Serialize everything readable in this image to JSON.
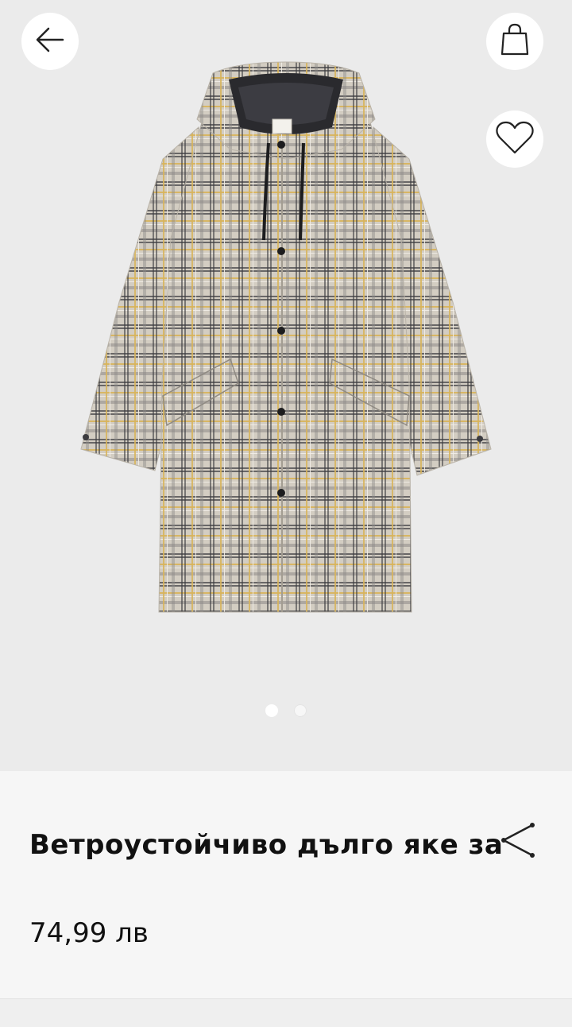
{
  "product": {
    "title": "Ветроустойчиво дълго яке за",
    "price": "74,99 лв"
  },
  "gallery": {
    "image_alt": "plaid-hooded-long-coat",
    "slides": [
      {
        "active": true
      },
      {
        "active": false
      }
    ]
  },
  "icons": {
    "back": "arrow-left-icon",
    "bag": "shopping-bag-icon",
    "favorite": "heart-icon",
    "share": "share-icon"
  },
  "colors": {
    "hero_bg": "#ebebeb",
    "coat_base": "#cfc9bd",
    "plaid_dark": "#3c3c40",
    "plaid_yellow": "#d9b45a",
    "text": "#111111"
  }
}
